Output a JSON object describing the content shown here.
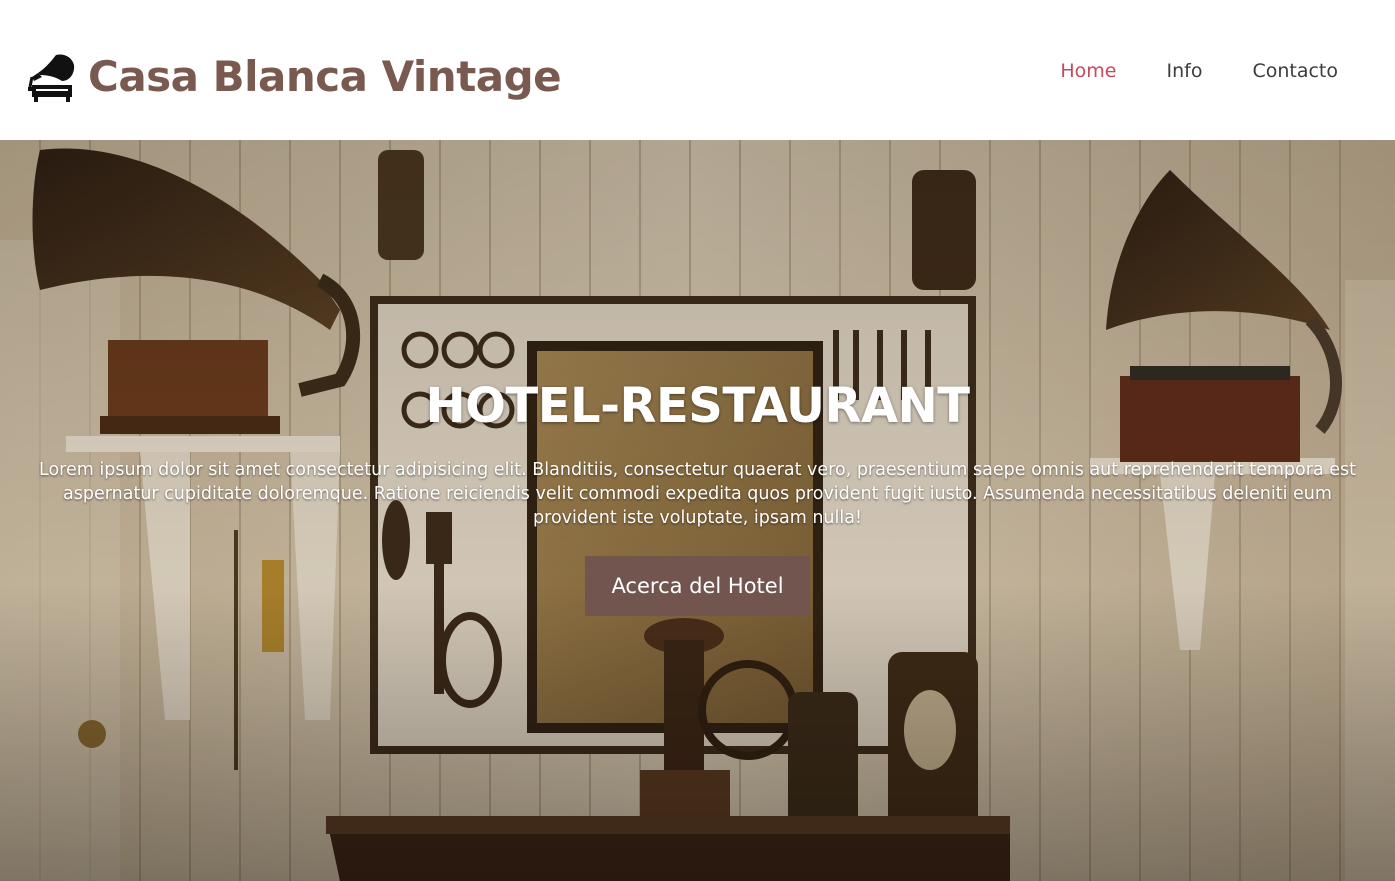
{
  "header": {
    "logo_icon": "gramophone-icon",
    "brand_title": "Casa Blanca Vintage",
    "nav": [
      {
        "label": "Home",
        "active": true
      },
      {
        "label": "Info",
        "active": false
      },
      {
        "label": "Contacto",
        "active": false
      }
    ]
  },
  "hero": {
    "title": "HOTEL-RESTAURANT",
    "text": "Lorem ipsum dolor sit amet consectetur adipisicing elit. Blanditiis, consectetur quaerat vero, praesentium saepe omnis aut reprehenderit tempora est aspernatur cupiditate doloremque. Ratione reiciendis velit commodi expedita quos provident fugit iusto. Assumenda necessitatibus deleniti eum provident iste voluptate, ipsam nulla!",
    "button_label": "Acerca del Hotel"
  },
  "colors": {
    "brand": "#7a5a50",
    "nav_active": "#c7495e",
    "nav_text": "#3d3d3d",
    "button_bg": "#735550"
  }
}
